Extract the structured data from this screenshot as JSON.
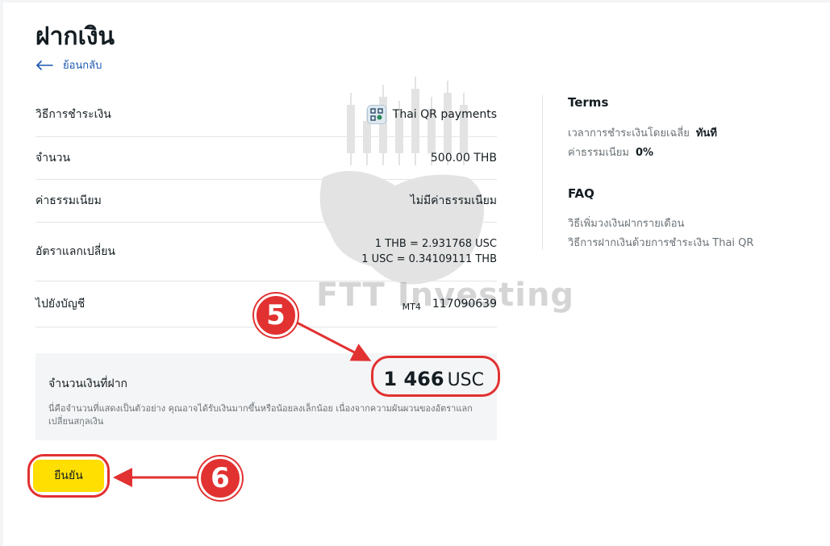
{
  "page": {
    "title": "ฝากเงิน",
    "back_label": "ย้อนกลับ"
  },
  "details": {
    "payment_method": {
      "label": "วิธีการชำระเงิน",
      "value": "Thai QR payments",
      "icon": "qr-code-icon"
    },
    "amount": {
      "label": "จำนวน",
      "value": "500.00 THB"
    },
    "fee": {
      "label": "ค่าธรรมเนียม",
      "value": "ไม่มีค่าธรรมเนียม"
    },
    "exchange_rate": {
      "label": "อัตราแลกเปลี่ยน",
      "line1": "1 THB = 2.931768 USC",
      "line2": "1 USC = 0.34109111 THB"
    },
    "to_account": {
      "label": "ไปยังบัญชี",
      "account_type": "MT4",
      "account_number": "117090639"
    }
  },
  "deposit": {
    "label": "จำนวนเงินที่ฝาก",
    "amount": "1 466",
    "unit": "USC",
    "note": "นี่คือจำนวนที่แสดงเป็นตัวอย่าง คุณอาจได้รับเงินมากขึ้นหรือน้อยลงเล็กน้อย เนื่องจากความผันผวนของอัตราแลกเปลี่ยนสกุลเงิน"
  },
  "confirm_label": "ยืนยัน",
  "annotations": {
    "step5": "5",
    "step6": "6",
    "color": "#e23131"
  },
  "watermark": {
    "text": "FTT Investing"
  },
  "sidebar": {
    "terms": {
      "heading": "Terms",
      "rows": [
        {
          "label": "เวลาการชำระเงินโดยเฉลี่ย",
          "value": "ทันที"
        },
        {
          "label": "ค่าธรรมเนียม",
          "value": "0%"
        }
      ]
    },
    "faq": {
      "heading": "FAQ",
      "links": [
        "วิธีเพิ่มวงเงินฝากรายเดือน",
        "วิธีการฝากเงินด้วยการชำระเงิน Thai QR"
      ]
    }
  },
  "colors": {
    "accent_yellow": "#ffde02",
    "link_blue": "#1a56b0",
    "text": "#141d22",
    "muted": "#6b7277"
  }
}
